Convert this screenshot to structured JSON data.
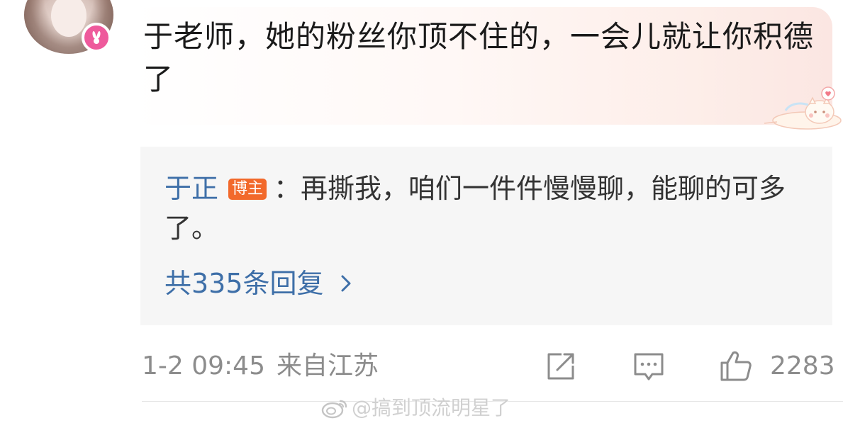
{
  "comment": {
    "text": "于老师，她的粉丝你顶不住的，一会儿就让你积德了"
  },
  "reply_preview": {
    "author": "于正",
    "author_tag": "博主",
    "separator": "：",
    "text": "再撕我，咱们一件件慢慢聊，能聊的可多了。",
    "count_label": "共335条回复"
  },
  "footer": {
    "date": "1-2 09:45",
    "location": "来自江苏",
    "like_count": "2283"
  },
  "watermark": {
    "text": "@搞到顶流明星了"
  },
  "icons": {
    "vip": "rabbit-vip-icon",
    "share": "share-icon",
    "reply": "comment-icon",
    "like": "thumbs-up-icon",
    "chevron": "chevron-right-icon",
    "decoration": "cat-sticker-icon",
    "watermark_logo": "weibo-logo-icon"
  },
  "colors": {
    "link_blue": "#3e6fa8",
    "author_tag": "#f2692b",
    "vip_pink": "#ee5a9c",
    "meta_gray": "#8c8c8c"
  }
}
